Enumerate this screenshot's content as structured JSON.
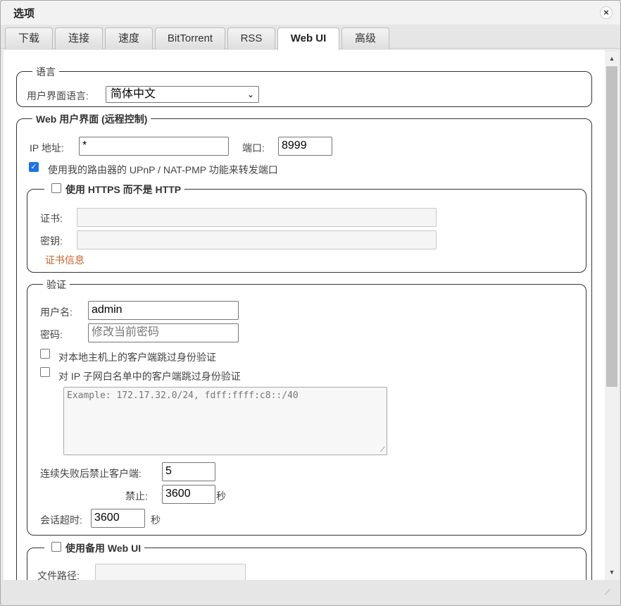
{
  "window": {
    "title": "选项",
    "close_glyph": "×"
  },
  "tabs": [
    {
      "label": "下载"
    },
    {
      "label": "连接"
    },
    {
      "label": "速度"
    },
    {
      "label": "BitTorrent"
    },
    {
      "label": "RSS"
    },
    {
      "label": "Web UI",
      "active": true
    },
    {
      "label": "高级"
    }
  ],
  "language": {
    "legend": "语言",
    "ui_language_label": "用户界面语言:",
    "ui_language_value": "简体中文"
  },
  "webui": {
    "legend": "Web 用户界面 (远程控制)",
    "ip_label": "IP 地址:",
    "ip_value": "*",
    "port_label": "端口:",
    "port_value": "8999",
    "upnp_label": "使用我的路由器的 UPnP / NAT-PMP 功能来转发端口",
    "upnp_checked": true
  },
  "https": {
    "legend": "使用 HTTPS 而不是 HTTP",
    "checked": false,
    "cert_label": "证书:",
    "key_label": "密钥:",
    "cert_info_link": "证书信息"
  },
  "auth": {
    "legend": "验证",
    "username_label": "用户名:",
    "username_value": "admin",
    "password_label": "密码:",
    "password_placeholder": "修改当前密码",
    "bypass_localhost_label": "对本地主机上的客户端跳过身份验证",
    "bypass_whitelist_label": "对 IP 子网白名单中的客户端跳过身份验证",
    "whitelist_placeholder": "Example: 172.17.32.0/24, fdff:ffff:c8::/40",
    "ban_after_label": "连续失败后禁止客户端:",
    "ban_after_value": "5",
    "ban_for_label": "禁止:",
    "ban_for_value": "3600",
    "ban_for_unit": "秒",
    "session_timeout_label": "会话超时:",
    "session_timeout_value": "3600",
    "session_timeout_unit": "秒"
  },
  "alt_webui": {
    "legend": "使用备用 Web UI",
    "checked": false,
    "path_label": "文件路径:"
  },
  "icons": {
    "chevron": "⌄",
    "check": "✓",
    "scroll_up": "▲",
    "scroll_down": "▼",
    "grip": "⟋"
  }
}
